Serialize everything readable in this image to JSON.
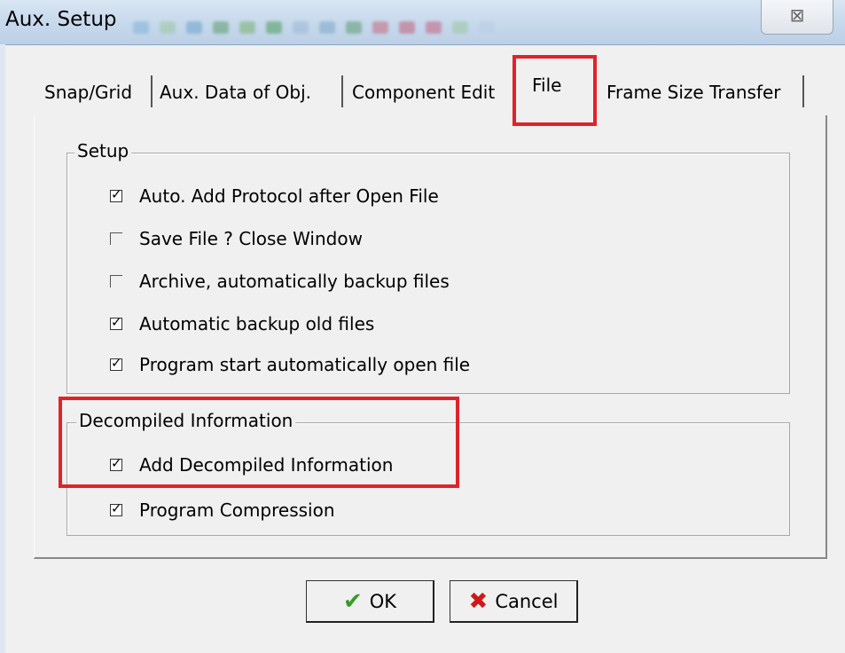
{
  "window": {
    "title": "Aux. Setup",
    "close_glyph": "⊠"
  },
  "tabs": [
    {
      "label": "Snap/Grid"
    },
    {
      "label": "Aux. Data of Obj."
    },
    {
      "label": "Component Edit"
    },
    {
      "label": "File",
      "active": true
    },
    {
      "label": "Frame Size Transfer"
    }
  ],
  "setup_group": {
    "label": "Setup",
    "items": [
      {
        "label": "Auto. Add Protocol after Open File",
        "checked": true
      },
      {
        "label": "Save File ? Close Window",
        "checked": false
      },
      {
        "label": "Archive, automatically backup files",
        "checked": false
      },
      {
        "label": "Automatic backup old files",
        "checked": true
      },
      {
        "label": "Program start automatically open file",
        "checked": true
      }
    ]
  },
  "decompiled_group": {
    "label": "Decompiled Information",
    "items": [
      {
        "label": "Add Decompiled Information",
        "checked": true
      },
      {
        "label": "Program Compression",
        "checked": true
      }
    ]
  },
  "buttons": {
    "ok_label": "OK",
    "ok_icon": "check-icon",
    "ok_color": "#3a9a2a",
    "cancel_label": "Cancel",
    "cancel_icon": "x-icon",
    "cancel_color": "#d01818"
  },
  "colors": {
    "highlight": "#e0232a"
  }
}
